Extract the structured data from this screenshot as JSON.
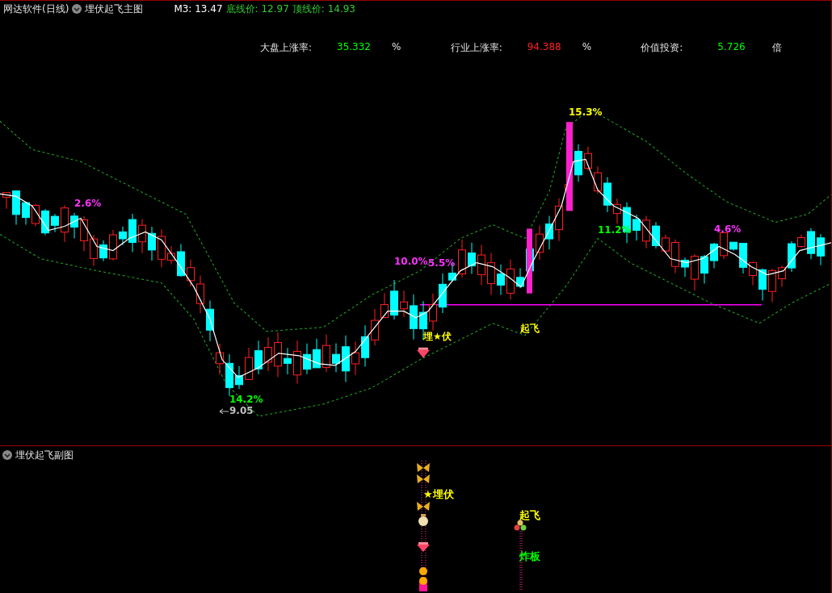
{
  "header": {
    "software": "网达软件(日线)",
    "indicator": "埋伏起飞主图",
    "readouts": [
      {
        "text": "M3: 13.47",
        "color": "#ffffff"
      },
      {
        "text": "底线价: 12.97",
        "color": "#33cc33"
      },
      {
        "text": "顶线价: 14.93",
        "color": "#33cc33"
      }
    ]
  },
  "stats": [
    {
      "label": "大盘上涨率:",
      "value": "35.332",
      "unit": "%",
      "color": "#00ff00"
    },
    {
      "label": "行业上涨率:",
      "value": "94.388",
      "unit": "%",
      "color": "#ff2020"
    },
    {
      "label": "价值投资:",
      "value": "5.726",
      "unit": "倍",
      "color": "#00ff00"
    }
  ],
  "annotations": [
    {
      "text": "2.6%",
      "color": "#ff33ff"
    },
    {
      "text": "14.2%",
      "color": "#00ff00"
    },
    {
      "text": "9.05",
      "color": "#c0c0c0"
    },
    {
      "text": "10.0%",
      "color": "#ff33ff"
    },
    {
      "text": "5.5%",
      "color": "#ff33ff"
    },
    {
      "text": "埋★伏",
      "color": "#ffff00"
    },
    {
      "text": "起飞",
      "color": "#ffff00"
    },
    {
      "text": "15.3%",
      "color": "#ffff00"
    },
    {
      "text": "11.2%",
      "color": "#00ff00"
    },
    {
      "text": "4.6%",
      "color": "#ff33ff"
    }
  ],
  "sub_panel": {
    "title": "埋伏起飞副图",
    "labels": [
      {
        "text": "★埋伏",
        "color": "#ffff00"
      },
      {
        "text": "起飞",
        "color": "#ffff00"
      },
      {
        "text": "炸板",
        "color": "#00ff00"
      }
    ]
  }
}
